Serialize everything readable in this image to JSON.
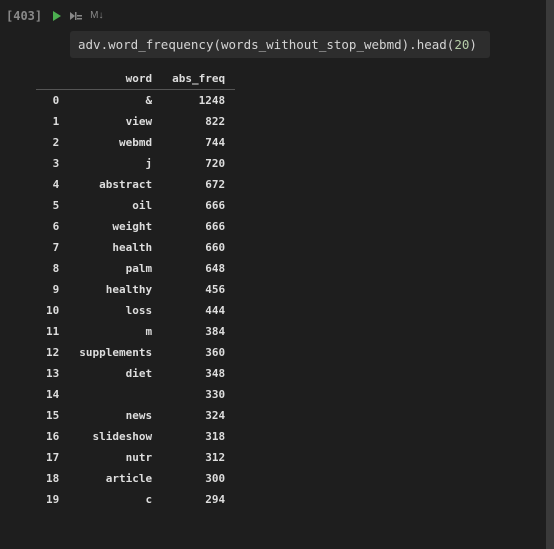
{
  "cell": {
    "exec_count": "[403]",
    "md_label": "M↓",
    "code_parts": {
      "obj": "adv",
      "dot1": ".",
      "fn1": "word_frequency",
      "p1": "(",
      "arg": "words_without_stop_webmd",
      "p2": ")",
      "dot2": ".",
      "fn2": "head",
      "p3": "(",
      "num": "20",
      "p4": ")"
    }
  },
  "output": {
    "columns": {
      "idx": "",
      "word": "word",
      "freq": "abs_freq"
    },
    "rows": [
      {
        "idx": "0",
        "word": "&",
        "freq": "1248"
      },
      {
        "idx": "1",
        "word": "view",
        "freq": "822"
      },
      {
        "idx": "2",
        "word": "webmd",
        "freq": "744"
      },
      {
        "idx": "3",
        "word": "j",
        "freq": "720"
      },
      {
        "idx": "4",
        "word": "abstract",
        "freq": "672"
      },
      {
        "idx": "5",
        "word": "oil",
        "freq": "666"
      },
      {
        "idx": "6",
        "word": "weight",
        "freq": "666"
      },
      {
        "idx": "7",
        "word": "health",
        "freq": "660"
      },
      {
        "idx": "8",
        "word": "palm",
        "freq": "648"
      },
      {
        "idx": "9",
        "word": "healthy",
        "freq": "456"
      },
      {
        "idx": "10",
        "word": "loss",
        "freq": "444"
      },
      {
        "idx": "11",
        "word": "m",
        "freq": "384"
      },
      {
        "idx": "12",
        "word": "supplements",
        "freq": "360"
      },
      {
        "idx": "13",
        "word": "diet",
        "freq": "348"
      },
      {
        "idx": "14",
        "word": "",
        "freq": "330"
      },
      {
        "idx": "15",
        "word": "news",
        "freq": "324"
      },
      {
        "idx": "16",
        "word": "slideshow",
        "freq": "318"
      },
      {
        "idx": "17",
        "word": "nutr",
        "freq": "312"
      },
      {
        "idx": "18",
        "word": "article",
        "freq": "300"
      },
      {
        "idx": "19",
        "word": "c",
        "freq": "294"
      }
    ]
  }
}
